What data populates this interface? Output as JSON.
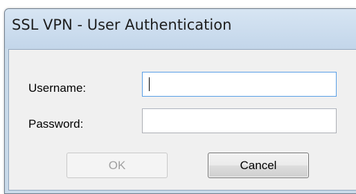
{
  "window": {
    "title": "SSL VPN - User Authentication"
  },
  "form": {
    "username_label": "Username:",
    "username_value": "",
    "password_label": "Password:",
    "password_value": ""
  },
  "buttons": {
    "ok_label": "OK",
    "cancel_label": "Cancel"
  }
}
